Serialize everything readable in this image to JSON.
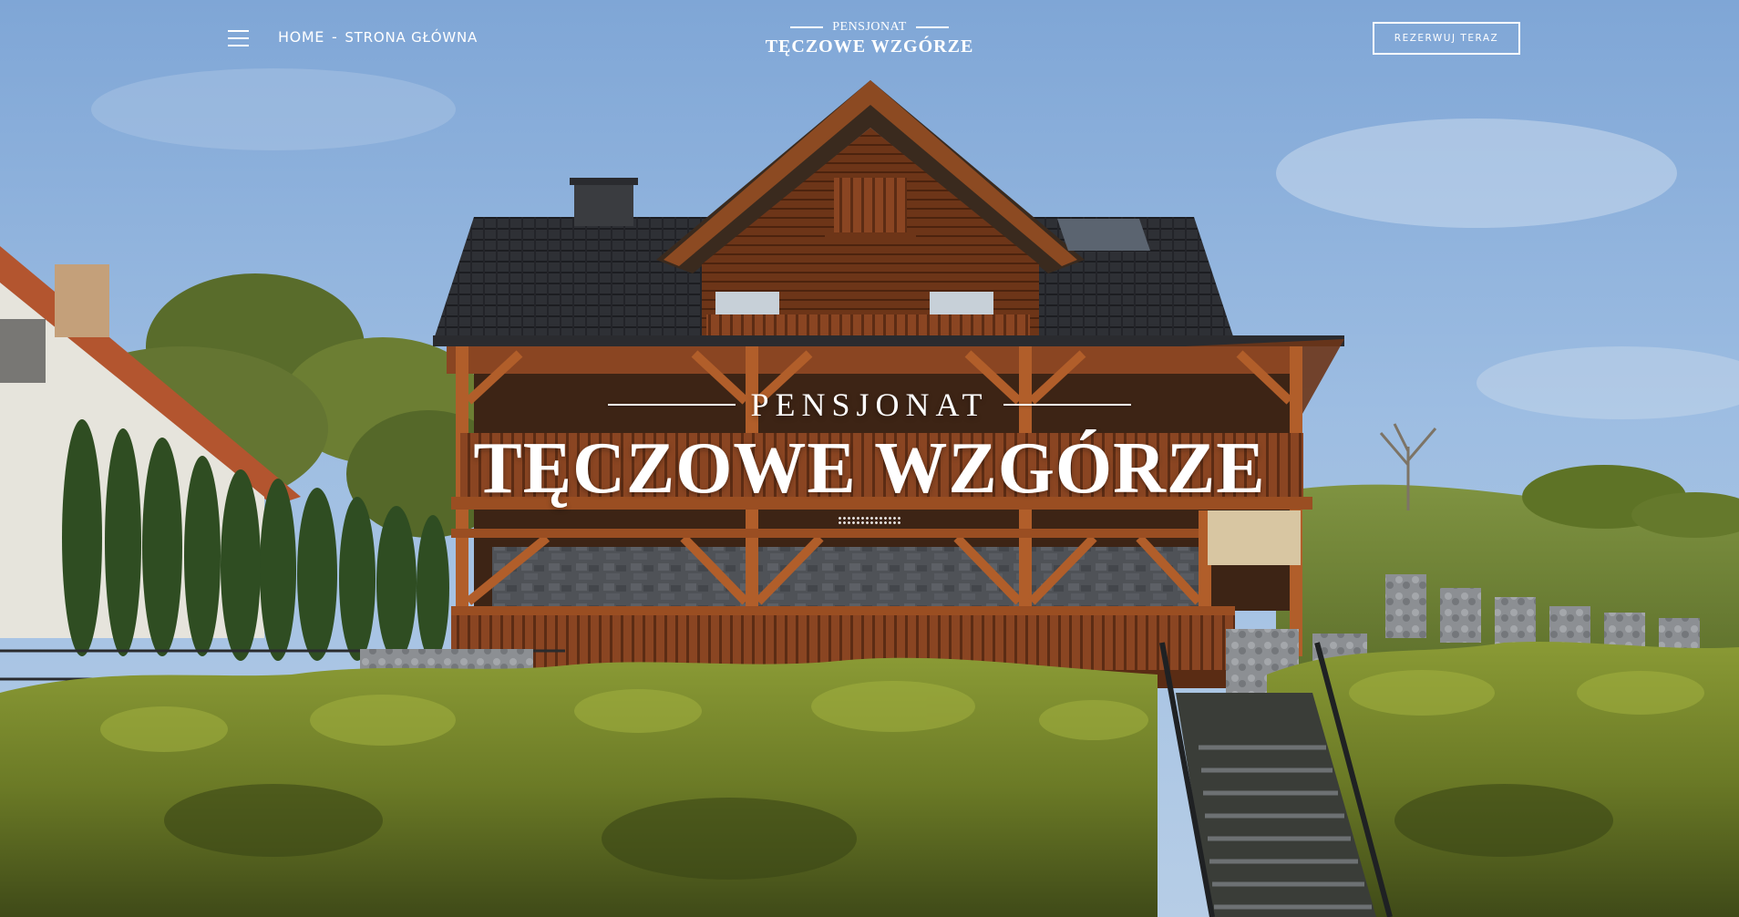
{
  "header": {
    "menu_icon": "hamburger-menu-icon",
    "breadcrumb": {
      "home": "HOME",
      "separator": "-",
      "current": "STRONA GŁÓWNA"
    },
    "logo": {
      "top": "PENSJONAT",
      "main": "TĘCZOWE WZGÓRZE"
    },
    "book_button": "REZERWUJ TERAZ"
  },
  "hero": {
    "subtitle": "PENSJONAT",
    "title": "TĘCZOWE WZGÓRZE",
    "divider_icon": "dotted-ornament-icon"
  },
  "colors": {
    "sky": "#8fb1d8",
    "wood": "#7a3f1f",
    "roof": "#2b2d31",
    "foliage": "#6f7d2a",
    "text": "#ffffff"
  }
}
